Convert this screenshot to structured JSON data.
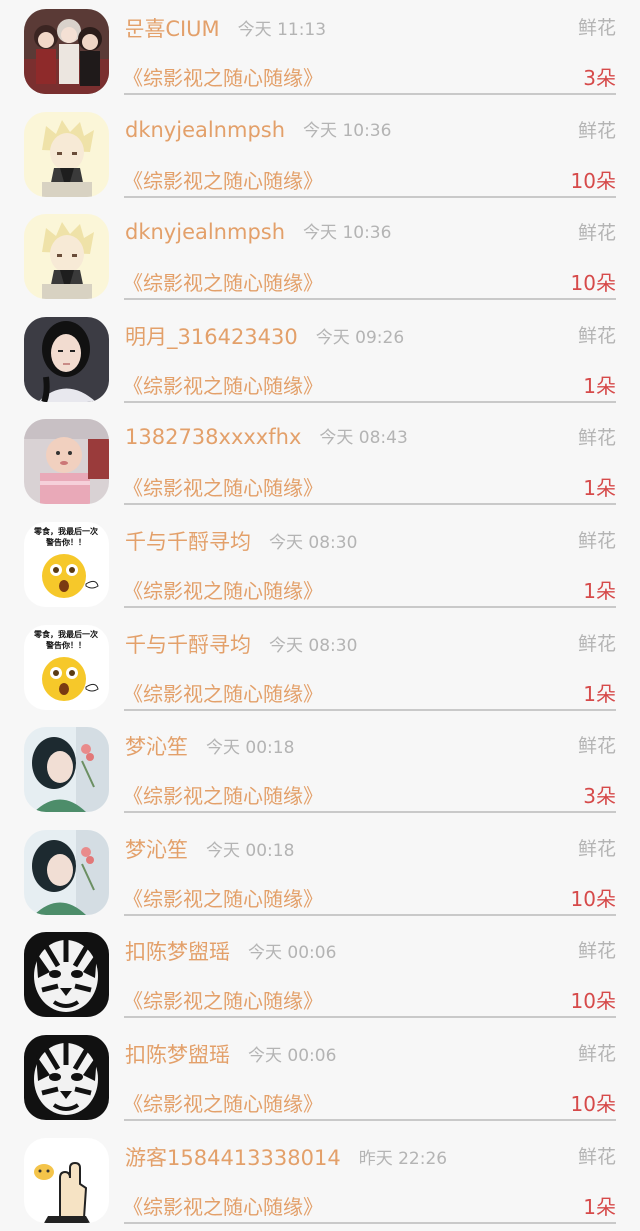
{
  "records": [
    {
      "name": "문喜CIUM",
      "time": "今天 11:13",
      "gift": "鲜花",
      "book": "《综影视之随心随缘》",
      "count": "3朵",
      "avatar": "anime-group-avatar"
    },
    {
      "name": "dknyjealnmpsh",
      "time": "今天 10:36",
      "gift": "鲜花",
      "book": "《综影视之随心随缘》",
      "count": "10朵",
      "avatar": "anime-boy-avatar"
    },
    {
      "name": "dknyjealnmpsh",
      "time": "今天 10:36",
      "gift": "鲜花",
      "book": "《综影视之随心随缘》",
      "count": "10朵",
      "avatar": "anime-boy-avatar"
    },
    {
      "name": "明月_316423430",
      "time": "今天 09:26",
      "gift": "鲜花",
      "book": "《综影视之随心随缘》",
      "count": "1朵",
      "avatar": "girl-photo-avatar"
    },
    {
      "name": "1382738xxxxfhx",
      "time": "今天 08:43",
      "gift": "鲜花",
      "book": "《综影视之随心随缘》",
      "count": "1朵",
      "avatar": "baby-photo-avatar"
    },
    {
      "name": "千与千酹寻均",
      "time": "今天 08:30",
      "gift": "鲜花",
      "book": "《综影视之随心随缘》",
      "count": "1朵",
      "avatar": "emoji-meme-avatar",
      "avatar_text_1": "零食，我最后一次",
      "avatar_text_2": "警告你！！"
    },
    {
      "name": "千与千酹寻均",
      "time": "今天 08:30",
      "gift": "鲜花",
      "book": "《综影视之随心随缘》",
      "count": "1朵",
      "avatar": "emoji-meme-avatar",
      "avatar_text_1": "零食，我最后一次",
      "avatar_text_2": "警告你！！"
    },
    {
      "name": "梦沁笙",
      "time": "今天 00:18",
      "gift": "鲜花",
      "book": "《综影视之随心随缘》",
      "count": "3朵",
      "avatar": "woman-flower-avatar"
    },
    {
      "name": "梦沁笙",
      "time": "今天 00:18",
      "gift": "鲜花",
      "book": "《综影视之随心随缘》",
      "count": "10朵",
      "avatar": "woman-flower-avatar"
    },
    {
      "name": "扣陈梦盥瑶",
      "time": "今天 00:06",
      "gift": "鲜花",
      "book": "《综影视之随心随缘》",
      "count": "10朵",
      "avatar": "tiger-avatar"
    },
    {
      "name": "扣陈梦盥瑶",
      "time": "今天 00:06",
      "gift": "鲜花",
      "book": "《综影视之随心随缘》",
      "count": "10朵",
      "avatar": "tiger-avatar"
    },
    {
      "name": "游客1584413338014",
      "time": "昨天 22:26",
      "gift": "鲜花",
      "book": "《综影视之随心随缘》",
      "count": "1朵",
      "avatar": "hand-cartoon-avatar"
    }
  ],
  "colors": {
    "name": "#e3a06a",
    "time": "#b4b4b4",
    "count": "#d64a4a",
    "background": "#f7f7f7"
  }
}
